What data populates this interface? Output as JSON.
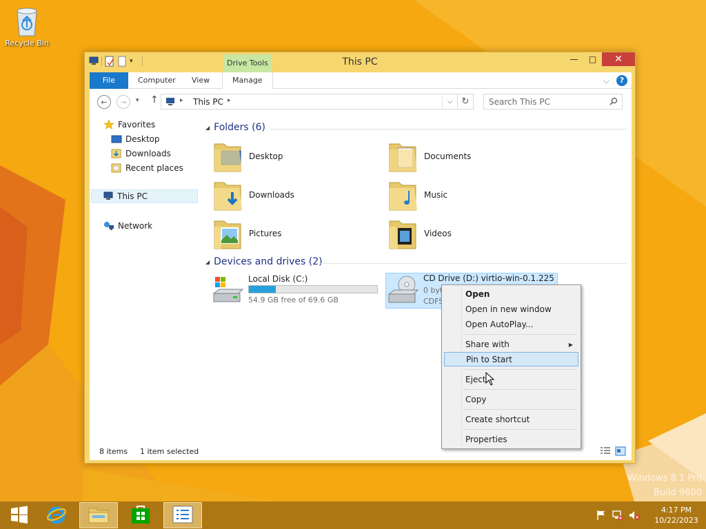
{
  "desktop": {
    "recycle_bin_label": "Recycle Bin",
    "watermark_line1": "Windows 8.1 Pro",
    "watermark_line2": "Build 9600"
  },
  "window": {
    "title": "This PC",
    "contextual_tab_group": "Drive Tools",
    "tabs": [
      "File",
      "Computer",
      "View",
      "Manage"
    ],
    "minimize_glyph": "—",
    "maximize_glyph": "□",
    "close_glyph": "✕",
    "help_glyph": "?"
  },
  "address_bar": {
    "path": "This PC",
    "search_placeholder": "Search This PC"
  },
  "nav_pane": {
    "favorites": "Favorites",
    "desktop": "Desktop",
    "downloads": "Downloads",
    "recent_places": "Recent places",
    "this_pc": "This PC",
    "network": "Network"
  },
  "folders_group": {
    "header": "Folders (6)",
    "items": [
      "Desktop",
      "Documents",
      "Downloads",
      "Music",
      "Pictures",
      "Videos"
    ]
  },
  "drives_group": {
    "header": "Devices and drives (2)",
    "local_disk": {
      "name": "Local Disk (C:)",
      "free_text": "54.9 GB free of 69.6 GB",
      "used_fraction": 0.21
    },
    "cd_drive": {
      "name": "CD Drive (D:) virtio-win-0.1.225",
      "line2": "0 byt",
      "line3": "CDFS"
    }
  },
  "status_bar": {
    "items_count": "8 items",
    "selection": "1 item selected"
  },
  "context_menu": {
    "open": "Open",
    "open_new_window": "Open in new window",
    "open_autoplay": "Open AutoPlay...",
    "share_with": "Share with",
    "pin_to_start": "Pin to Start",
    "eject": "Eject",
    "copy": "Copy",
    "create_shortcut": "Create shortcut",
    "properties": "Properties"
  },
  "taskbar": {
    "time": "4:17 PM",
    "date": "10/22/2023"
  },
  "colors": {
    "accent": "#1979ca",
    "selection": "#cce8ff",
    "wallpaper": "#f2a20e"
  }
}
